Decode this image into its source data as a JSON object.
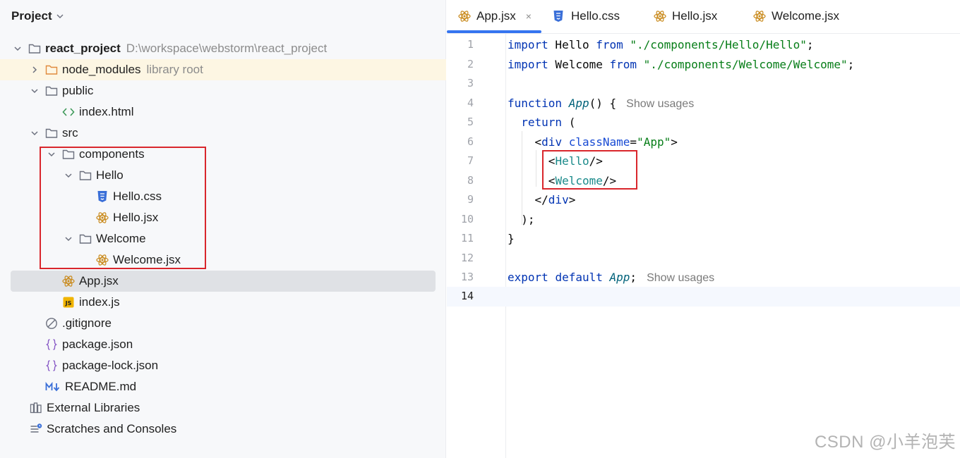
{
  "panel": {
    "title": "Project"
  },
  "tree": [
    {
      "label": "react_project",
      "hint": "D:\\workspace\\webstorm\\react_project",
      "icon": "folder-icon",
      "bold": true
    },
    {
      "label": "node_modules",
      "hint": "library root",
      "icon": "folder-orange-icon"
    },
    {
      "label": "public",
      "hint": "",
      "icon": "folder-icon"
    },
    {
      "label": "index.html",
      "hint": "",
      "icon": "html-icon"
    },
    {
      "label": "src",
      "hint": "",
      "icon": "folder-icon"
    },
    {
      "label": "components",
      "hint": "",
      "icon": "folder-icon"
    },
    {
      "label": "Hello",
      "hint": "",
      "icon": "folder-icon"
    },
    {
      "label": "Hello.css",
      "hint": "",
      "icon": "css-icon"
    },
    {
      "label": "Hello.jsx",
      "hint": "",
      "icon": "react-icon"
    },
    {
      "label": "Welcome",
      "hint": "",
      "icon": "folder-icon"
    },
    {
      "label": "Welcome.jsx",
      "hint": "",
      "icon": "react-icon"
    },
    {
      "label": "App.jsx",
      "hint": "",
      "icon": "react-icon"
    },
    {
      "label": "index.js",
      "hint": "",
      "icon": "js-icon"
    },
    {
      "label": ".gitignore",
      "hint": "",
      "icon": "ignore-icon"
    },
    {
      "label": "package.json",
      "hint": "",
      "icon": "json-icon"
    },
    {
      "label": "package-lock.json",
      "hint": "",
      "icon": "json-icon"
    },
    {
      "label": "README.md",
      "hint": "",
      "icon": "markdown-icon"
    },
    {
      "label": "External Libraries",
      "hint": "",
      "icon": "library-icon"
    },
    {
      "label": "Scratches and Consoles",
      "hint": "",
      "icon": "scratches-icon"
    }
  ],
  "tabs": [
    {
      "label": "App.jsx",
      "icon": "react-icon",
      "close": "×"
    },
    {
      "label": "Hello.css",
      "icon": "css-icon"
    },
    {
      "label": "Hello.jsx",
      "icon": "react-icon"
    },
    {
      "label": "Welcome.jsx",
      "icon": "react-icon"
    }
  ],
  "code": {
    "line_numbers": [
      "1",
      "2",
      "3",
      "4",
      "5",
      "6",
      "7",
      "8",
      "9",
      "10",
      "11",
      "12",
      "13",
      "14"
    ],
    "l1": {
      "kw1": "import",
      "name": " Hello ",
      "kw2": "from",
      "sp": " ",
      "str": "\"./components/Hello/Hello\"",
      "end": ";"
    },
    "l2": {
      "kw1": "import",
      "name": " Welcome ",
      "kw2": "from",
      "sp": " ",
      "str": "\"./components/Welcome/Welcome\"",
      "end": ";"
    },
    "l4": {
      "kw": "function",
      "sp": " ",
      "fn": "App",
      "rest": "() {",
      "usage": "Show usages"
    },
    "l5": {
      "indent": "  ",
      "kw": "return",
      "rest": " ("
    },
    "l6": {
      "indent": "    ",
      "open": "<",
      "tag": "div",
      "sp": " ",
      "attr": "className",
      "eq": "=",
      "str": "\"App\"",
      "close": ">"
    },
    "l7": {
      "indent": "      ",
      "open": "<",
      "comp": "Hello",
      "close": "/>"
    },
    "l8": {
      "indent": "      ",
      "open": "<",
      "comp": "Welcome",
      "close": "/>"
    },
    "l9": {
      "indent": "    ",
      "open": "</",
      "tag": "div",
      "close": ">"
    },
    "l10": {
      "indent": "  ",
      "text": ");"
    },
    "l11": {
      "text": "}"
    },
    "l13": {
      "kw1": "export",
      "sp1": " ",
      "kw2": "default",
      "sp2": " ",
      "fn": "App",
      "end": ";",
      "usage": "Show usages"
    }
  },
  "watermark": "CSDN @小羊泡芙"
}
